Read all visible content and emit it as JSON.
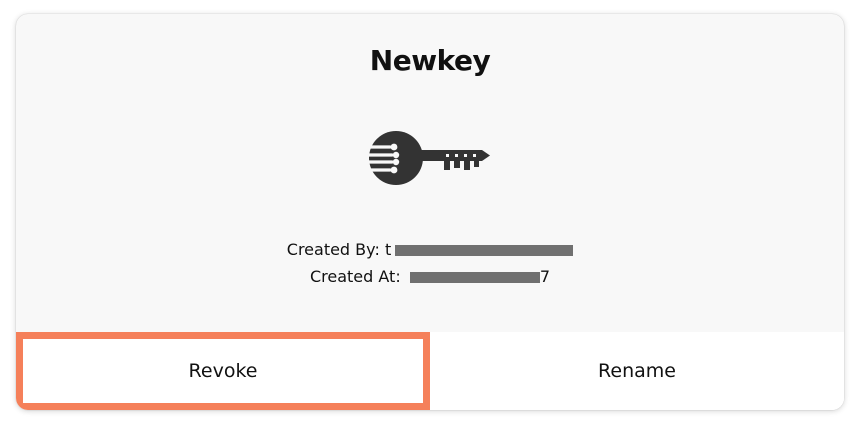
{
  "card": {
    "title": "Newkey",
    "created_by_label": "Created By:",
    "created_by_value": "t",
    "created_at_label": "Created At:",
    "created_at_value": "7"
  },
  "actions": {
    "revoke_label": "Revoke",
    "rename_label": "Rename"
  },
  "icons": {
    "key": "key-icon"
  },
  "colors": {
    "highlight": "#f5805a",
    "key_icon": "#333333"
  }
}
